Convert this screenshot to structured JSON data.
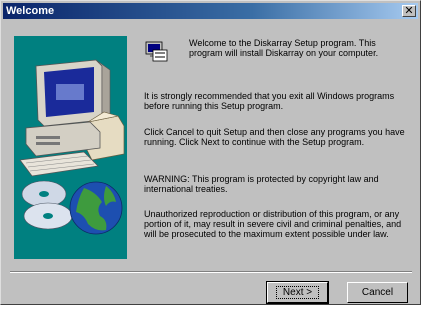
{
  "window": {
    "title": "Welcome",
    "close_glyph": "✕"
  },
  "content": {
    "intro": "Welcome to the Diskarray Setup program.  This program will install Diskarray on your computer.",
    "recommend": "It is strongly recommended that you exit all Windows programs before running this Setup program.",
    "instructions": "Click Cancel to quit Setup and then close any programs you have running.  Click Next to continue with the Setup program.",
    "warning": "WARNING: This program is protected by copyright law and international treaties.",
    "unauthorized": "Unauthorized reproduction or distribution of this program, or any portion of it, may result in severe civil and criminal penalties, and will be prosecuted to the maximum extent possible under law."
  },
  "buttons": {
    "next_label": "Next >",
    "cancel_label": "Cancel"
  },
  "icons": [
    "close-icon",
    "setup-icon",
    "computer-illustration",
    "cd-disc-icon",
    "globe-icon"
  ],
  "colors": {
    "title_bar": "#0a246a",
    "art_panel": "#008080",
    "dialog_face": "#c0c0c0"
  }
}
